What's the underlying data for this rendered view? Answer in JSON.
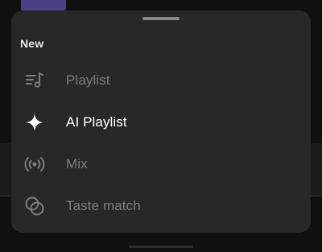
{
  "sheet": {
    "title": "New",
    "items": [
      {
        "label": "Playlist",
        "icon": "playlist-add-icon",
        "state": "dimmed"
      },
      {
        "label": "AI Playlist",
        "icon": "sparkle-icon",
        "state": "active"
      },
      {
        "label": "Mix",
        "icon": "broadcast-icon",
        "state": "dimmed"
      },
      {
        "label": "Taste match",
        "icon": "overlapping-circles-icon",
        "state": "dimmed"
      }
    ]
  },
  "colors": {
    "sheet_background": "#282828",
    "active_text": "#ffffff",
    "dimmed_text": "#7b7b7b",
    "accent_tab": "#4a3f86"
  }
}
